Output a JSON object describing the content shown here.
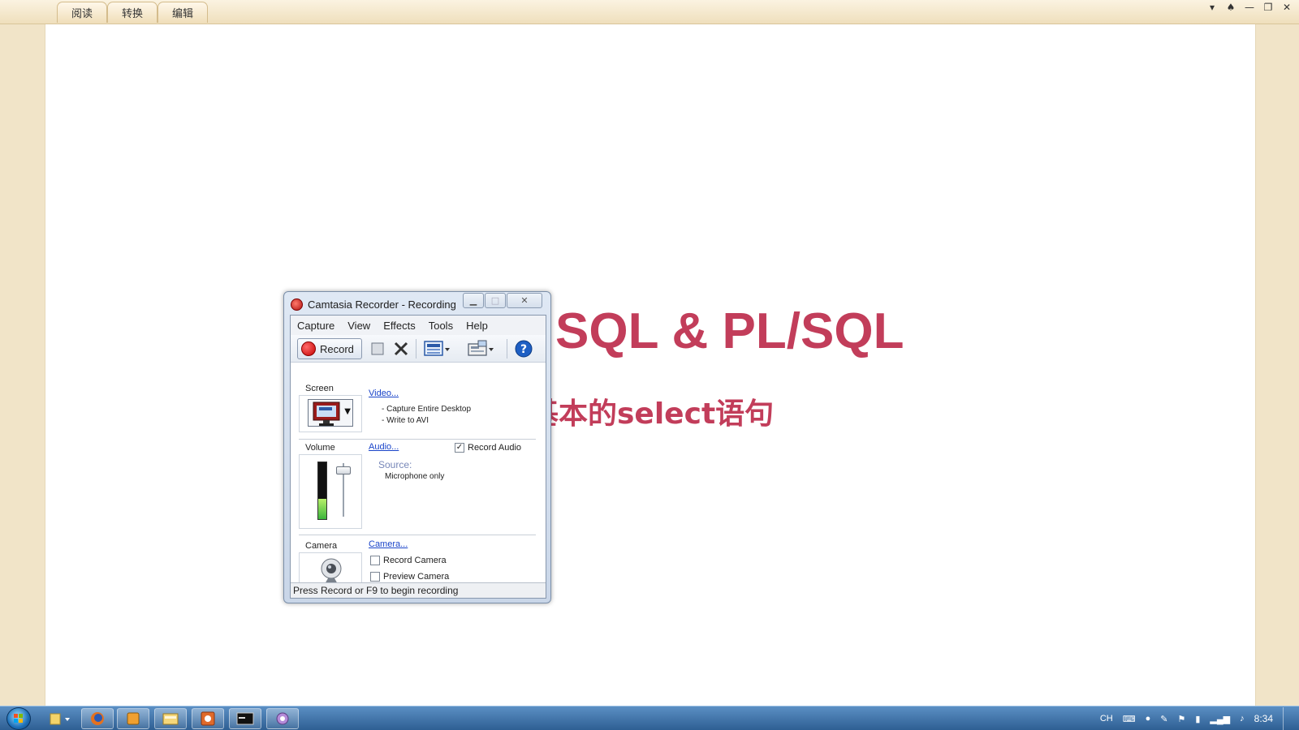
{
  "reader": {
    "tabs": [
      "阅读",
      "转换",
      "编辑"
    ],
    "window_controls": [
      "▾",
      "♠",
      "—",
      "❐",
      "✕"
    ]
  },
  "slide": {
    "title": "SQL & PL/SQL",
    "subtitle": "基本的select语句"
  },
  "camtasia": {
    "title": "Camtasia Recorder - Recording",
    "menu": [
      "Capture",
      "View",
      "Effects",
      "Tools",
      "Help"
    ],
    "record_label": "Record",
    "screen": {
      "label": "Screen",
      "link": "Video...",
      "info": [
        "- Capture Entire Desktop",
        "- Write to AVI"
      ]
    },
    "audio": {
      "label": "Volume",
      "link": "Audio...",
      "record_audio_label": "Record Audio",
      "record_audio_checked": true,
      "source_label": "Source:",
      "source_value": "Microphone only",
      "volume_level": 0.35
    },
    "camera": {
      "label": "Camera",
      "link": "Camera...",
      "record_camera_label": "Record Camera",
      "preview_camera_label": "Preview Camera"
    },
    "status": "Press Record or F9 to begin recording"
  },
  "taskbar": {
    "tray_lang": "CH",
    "clock": "8:34"
  }
}
